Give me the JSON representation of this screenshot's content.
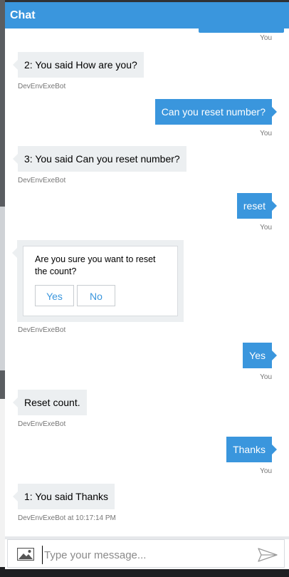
{
  "header": {
    "title": "Chat"
  },
  "messages": [
    {
      "from": "user",
      "sender": "You"
    },
    {
      "from": "bot",
      "text": "2: You said How are you?",
      "sender": "DevEnvExeBot"
    },
    {
      "from": "user",
      "text": "Can you reset number?",
      "sender": "You"
    },
    {
      "from": "bot",
      "text": "3: You said Can you reset number?",
      "sender": "DevEnvExeBot"
    },
    {
      "from": "user",
      "text": "reset",
      "sender": "You"
    },
    {
      "from": "bot",
      "card": {
        "text": "Are you sure you want to reset the count?",
        "buttons": [
          "Yes",
          "No"
        ]
      },
      "sender": "DevEnvExeBot"
    },
    {
      "from": "user",
      "text": "Yes",
      "sender": "You"
    },
    {
      "from": "bot",
      "text": "Reset count.",
      "sender": "DevEnvExeBot"
    },
    {
      "from": "user",
      "text": "Thanks",
      "sender": "You"
    },
    {
      "from": "bot",
      "text": "1: You said Thanks",
      "sender": "DevEnvExeBot at 10:17:14 PM"
    }
  ],
  "composer": {
    "placeholder": "Type your message..."
  },
  "icons": {
    "attach": "image-icon",
    "send": "send-icon"
  },
  "colors": {
    "accent": "#3a96dd",
    "bot_bubble": "#eceff1",
    "meta_text": "#767676"
  }
}
